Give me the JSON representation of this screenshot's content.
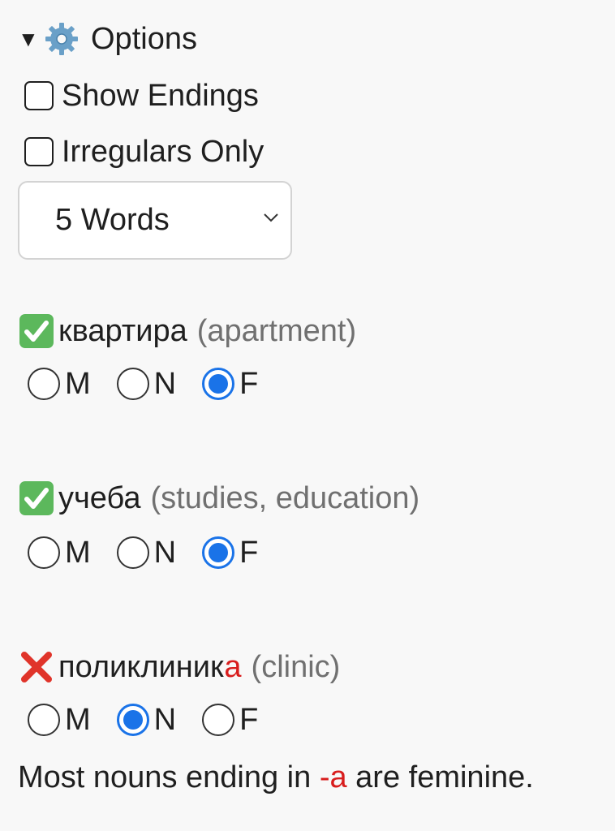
{
  "options": {
    "summary_label": "Options",
    "show_endings_label": "Show Endings",
    "irregulars_only_label": "Irregulars Only",
    "word_count_selected": "5 Words"
  },
  "words": [
    {
      "status": "correct",
      "word": "квартира",
      "gloss": "(apartment)",
      "selected": "F",
      "options": [
        "M",
        "N",
        "F"
      ]
    },
    {
      "status": "correct",
      "word": "учеба",
      "gloss": "(studies, education)",
      "selected": "F",
      "options": [
        "M",
        "N",
        "F"
      ]
    },
    {
      "status": "incorrect",
      "word_stem": "поликлиник",
      "word_ending": "а",
      "gloss": "(clinic)",
      "selected": "N",
      "options": [
        "M",
        "N",
        "F"
      ]
    }
  ],
  "hint": {
    "prefix": "Most nouns ending in ",
    "ending": "-a",
    "suffix": " are feminine."
  },
  "colors": {
    "accent": "#1a73e8",
    "error_highlight": "#d81d1d",
    "correct_mark": "#5cb85c",
    "incorrect_mark": "#e0342a"
  }
}
